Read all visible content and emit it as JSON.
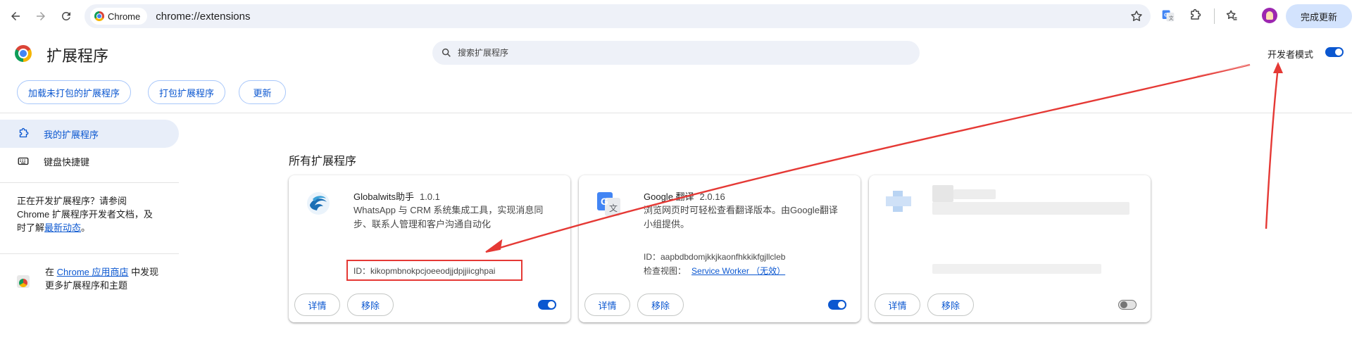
{
  "toolbar": {
    "chip_label": "Chrome",
    "url": "chrome://extensions",
    "update_label": "完成更新"
  },
  "header": {
    "title": "扩展程序",
    "search_placeholder": "搜索扩展程序",
    "dev_mode_label": "开发者模式",
    "dev_mode_on": true
  },
  "actions": {
    "load_unpacked": "加载未打包的扩展程序",
    "pack": "打包扩展程序",
    "update": "更新"
  },
  "sidebar": {
    "items": [
      {
        "label": "我的扩展程序",
        "icon": "puzzle-icon",
        "active": true
      },
      {
        "label": "键盘快捷键",
        "icon": "keyboard-icon",
        "active": false
      }
    ],
    "dev_note_prefix": "正在开发扩展程序？请参阅 Chrome 扩展程序开发者文档，及时了解",
    "dev_note_link": "最新动态",
    "dev_note_suffix": "。",
    "store_prefix": "在",
    "store_link": "Chrome 应用商店",
    "store_suffix": "中发现更多扩展程序和主题"
  },
  "main": {
    "section_title": "所有扩展程序",
    "details_label": "详情",
    "remove_label": "移除",
    "extensions": [
      {
        "name": "Globalwits助手",
        "version": "1.0.1",
        "description": "WhatsApp 与 CRM 系统集成工具，实现消息同步、联系人管理和客户沟通自动化",
        "id_text": "ID：kikopmbnokpcjoeeodjjdpjjiicghpai",
        "enabled": true,
        "icon": "globalwits-wave-icon"
      },
      {
        "name": "Google 翻译",
        "version": "2.0.16",
        "description": "浏览网页时可轻松查看翻译版本。由Google翻译小组提供。",
        "id_text": "ID：aapbdbdomjkkjkaonfhkkikfgjllcleb",
        "inspect_label": "检查视图：",
        "inspect_link": "Service Worker （无效）",
        "enabled": true,
        "icon": "google-translate-icon"
      },
      {
        "name": "",
        "version": "",
        "description": "",
        "enabled": false,
        "icon": "blurred-extension-icon"
      }
    ]
  },
  "colors": {
    "accent": "#0b57d0",
    "annotation_red": "#e53935"
  }
}
